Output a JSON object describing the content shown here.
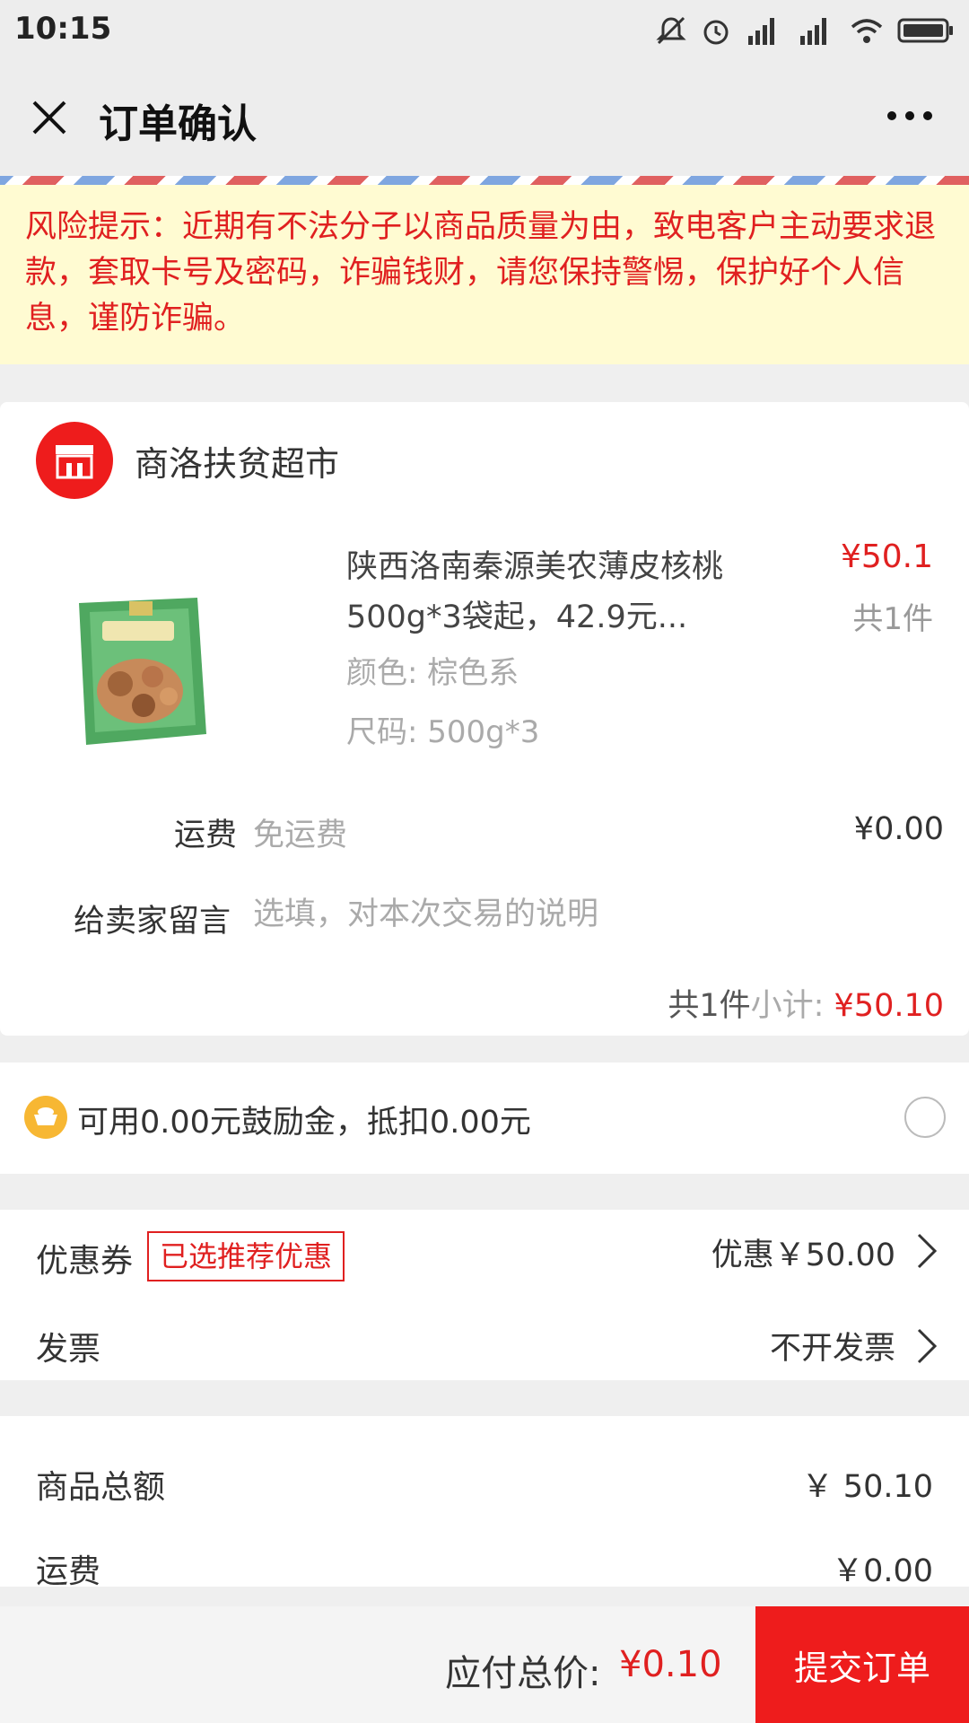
{
  "status_bar": {
    "time": "10:15",
    "icons": [
      "mute-icon",
      "alarm-icon",
      "signal-hd-icon",
      "signal-hd-icon",
      "wifi-icon",
      "battery-icon"
    ]
  },
  "nav": {
    "title": "订单确认",
    "close_icon": "close-icon",
    "more_icon": "more-icon"
  },
  "risk_notice": "风险提示：近期有不法分子以商品质量为由，致电客户主动要求退款，套取卡号及密码，诈骗钱财，请您保持警惕，保护好个人信息，谨防诈骗。",
  "shop": {
    "name": "商洛扶贫超市",
    "logo_icon": "store-icon"
  },
  "product": {
    "title": "陕西洛南秦源美农薄皮核桃500g*3袋起，42.9元...",
    "color_spec": "颜色: 棕色系",
    "size_spec": "尺码: 500g*3",
    "price": "¥50.1",
    "quantity": "共1件"
  },
  "shipping": {
    "label": "运费",
    "value": "免运费",
    "price": "¥0.00"
  },
  "message": {
    "label": "给卖家留言",
    "placeholder": "选填，对本次交易的说明"
  },
  "subtotal": {
    "quantity": "共1件",
    "label": "小计: ",
    "amount": "¥50.10"
  },
  "reward": {
    "text": "可用0.00元鼓励金，抵扣0.00元",
    "icon": "coin-icon",
    "selected": false
  },
  "coupon": {
    "label": "优惠券",
    "badge": "已选推荐优惠",
    "value": "优惠￥50.00"
  },
  "invoice": {
    "label": "发票",
    "value": "不开发票"
  },
  "summary": {
    "goods_label": "商品总额",
    "goods_value": "￥ 50.10",
    "shipping_label": "运费",
    "shipping_value": "￥0.00"
  },
  "bottom": {
    "total_label": "应付总价: ",
    "total_amount": "¥0.10",
    "submit_label": "提交订单"
  },
  "colors": {
    "accent_red": "#e02020",
    "button_red": "#ee1c1c",
    "notice_bg": "#fffbd2"
  }
}
